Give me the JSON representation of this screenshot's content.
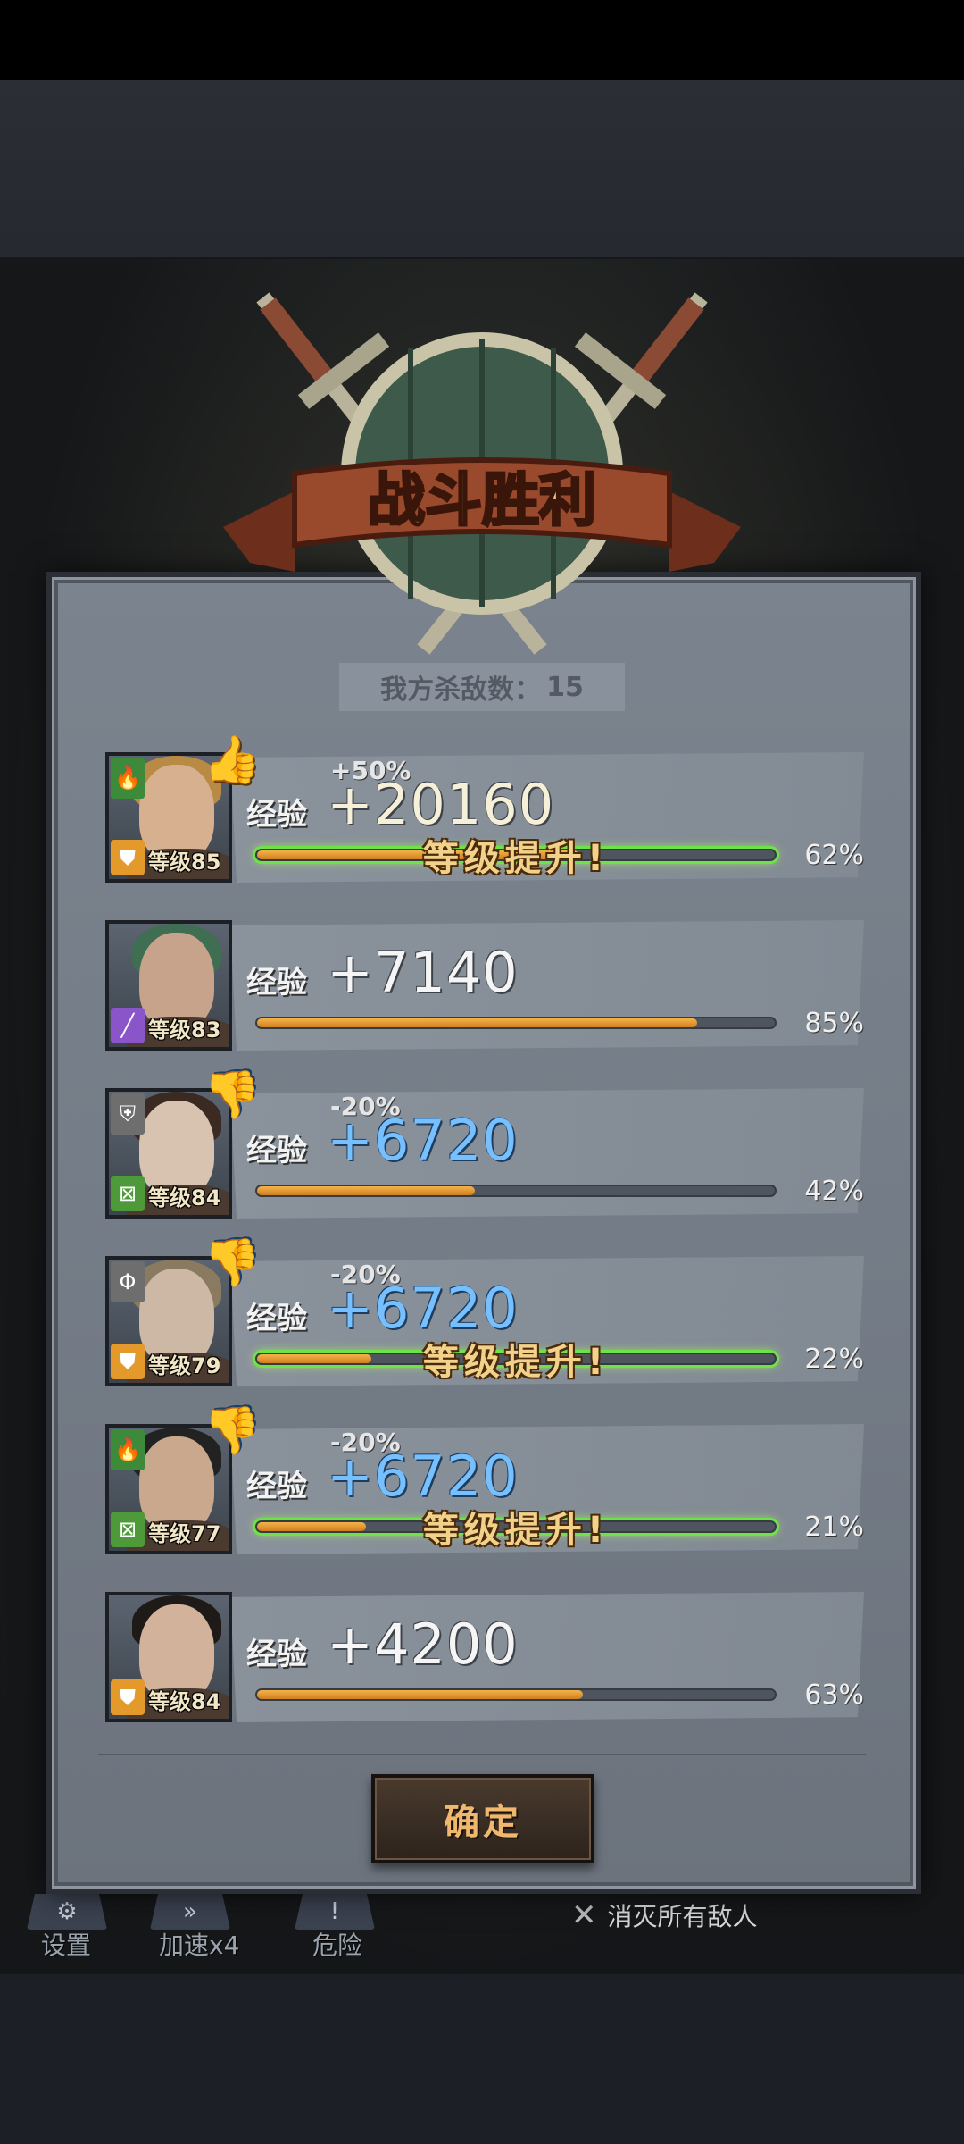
{
  "title": "战斗胜利",
  "kills": {
    "label": "我方杀敌数：",
    "value": "15"
  },
  "exp_label": "经验",
  "levelup_label": "等级提升!",
  "heroes": [
    {
      "level": "等级85",
      "bonus": "+50%",
      "exp": "+20160",
      "progress": 62,
      "progress_text": "62%",
      "level_up": true,
      "rating": "thumbs-up-icon",
      "class_color": "#3c8a3a",
      "role_color": "#e39a2a"
    },
    {
      "level": "等级83",
      "bonus": "",
      "exp": "+7140",
      "progress": 85,
      "progress_text": "85%",
      "level_up": false,
      "rating": "",
      "class_color": "",
      "role_color": "#8a55c8"
    },
    {
      "level": "等级84",
      "bonus": "-20%",
      "exp": "+6720",
      "progress": 42,
      "progress_text": "42%",
      "level_up": false,
      "rating": "thumbs-down-icon",
      "class_color": "#6e6e6e",
      "role_color": "#4e9a3a"
    },
    {
      "level": "等级79",
      "bonus": "-20%",
      "exp": "+6720",
      "progress": 22,
      "progress_text": "22%",
      "level_up": true,
      "rating": "thumbs-down-icon",
      "class_color": "#6e6e6e",
      "role_color": "#e39a2a"
    },
    {
      "level": "等级77",
      "bonus": "-20%",
      "exp": "+6720",
      "progress": 21,
      "progress_text": "21%",
      "level_up": true,
      "rating": "thumbs-down-icon",
      "class_color": "#3c8a3a",
      "role_color": "#4e9a3a"
    },
    {
      "level": "等级84",
      "bonus": "",
      "exp": "+4200",
      "progress": 63,
      "progress_text": "63%",
      "level_up": false,
      "rating": "",
      "class_color": "",
      "role_color": "#e39a2a"
    }
  ],
  "confirm_label": "确定",
  "bottom_nav": {
    "settings": "设置",
    "speed": "加速x4",
    "danger": "危险",
    "objective": "消灭所有敌人"
  },
  "colors": {
    "accent": "#f0b86e",
    "levelup_glow": "#6fe24a",
    "exp_bar": "#e79a30"
  }
}
